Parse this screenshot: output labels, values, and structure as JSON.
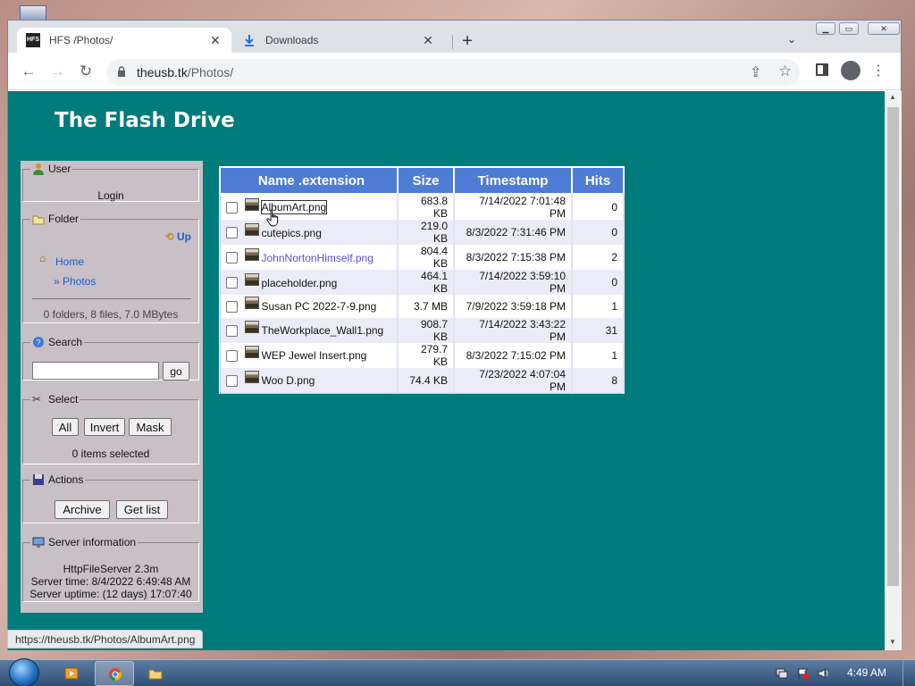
{
  "browser": {
    "tabs": [
      {
        "label": "HFS /Photos/"
      },
      {
        "label": "Downloads"
      }
    ],
    "url_host": "theusb.tk",
    "url_path": "/Photos/",
    "status_url": "https://theusb.tk/Photos/AlbumArt.png",
    "new_tab_label": "+"
  },
  "page": {
    "site_title": "The Flash Drive",
    "user": {
      "legend": "User",
      "login": "Login"
    },
    "folder": {
      "legend": "Folder",
      "up": "Up",
      "home": "Home",
      "current": "» Photos",
      "stats": "0 folders, 8 files, 7.0 MBytes"
    },
    "search": {
      "legend": "Search",
      "go": "go",
      "value": ""
    },
    "select": {
      "legend": "Select",
      "all": "All",
      "invert": "Invert",
      "mask": "Mask",
      "count": "0 items selected"
    },
    "actions": {
      "legend": "Actions",
      "archive": "Archive",
      "get_list": "Get list"
    },
    "server": {
      "legend": "Server information",
      "software": "HttpFileServer 2.3m",
      "time": "Server time: 8/4/2022 6:49:48 AM",
      "uptime": "Server uptime: (12 days) 17:07:40"
    },
    "table": {
      "headers": {
        "name": "Name .extension",
        "size": "Size",
        "timestamp": "Timestamp",
        "hits": "Hits"
      },
      "rows": [
        {
          "name": "AlbumArt.png",
          "size": "683.8 KB",
          "timestamp": "7/14/2022 7:01:48 PM",
          "hits": "0"
        },
        {
          "name": "cutepics.png",
          "size": "219.0 KB",
          "timestamp": "8/3/2022 7:31:46 PM",
          "hits": "0"
        },
        {
          "name": "JohnNortonHimself.png",
          "size": "804.4 KB",
          "timestamp": "8/3/2022 7:15:38 PM",
          "hits": "2"
        },
        {
          "name": "placeholder.png",
          "size": "464.1 KB",
          "timestamp": "7/14/2022 3:59:10 PM",
          "hits": "0"
        },
        {
          "name": "Susan PC 2022-7-9.png",
          "size": "3.7 MB",
          "timestamp": "7/9/2022 3:59:18 PM",
          "hits": "1"
        },
        {
          "name": "TheWorkplace_Wall1.png",
          "size": "908.7 KB",
          "timestamp": "7/14/2022 3:43:22 PM",
          "hits": "31"
        },
        {
          "name": "WEP Jewel Insert.png",
          "size": "279.7 KB",
          "timestamp": "8/3/2022 7:15:02 PM",
          "hits": "1"
        },
        {
          "name": "Woo D.png",
          "size": "74.4 KB",
          "timestamp": "7/23/2022 4:07:04 PM",
          "hits": "8"
        }
      ]
    }
  },
  "taskbar": {
    "clock": "4:49 AM"
  },
  "colors": {
    "page_bg": "#007b7b",
    "header_bg": "#4e7bd4",
    "panel_bg": "#c8c0c6",
    "link": "#1a5fd0",
    "visited": "#5a4fcf"
  },
  "icons": [
    "hfs-favicon",
    "download-icon",
    "back-arrow-icon",
    "forward-arrow-icon",
    "reload-icon",
    "lock-icon",
    "share-icon",
    "star-icon",
    "side-panel-icon",
    "profile-icon",
    "kebab-menu-icon",
    "user-icon",
    "folder-icon",
    "up-icon",
    "home-icon",
    "search-icon",
    "select-scissors-icon",
    "floppy-save-icon",
    "server-icon",
    "image-thumbnail-icon",
    "hand-cursor-icon"
  ]
}
